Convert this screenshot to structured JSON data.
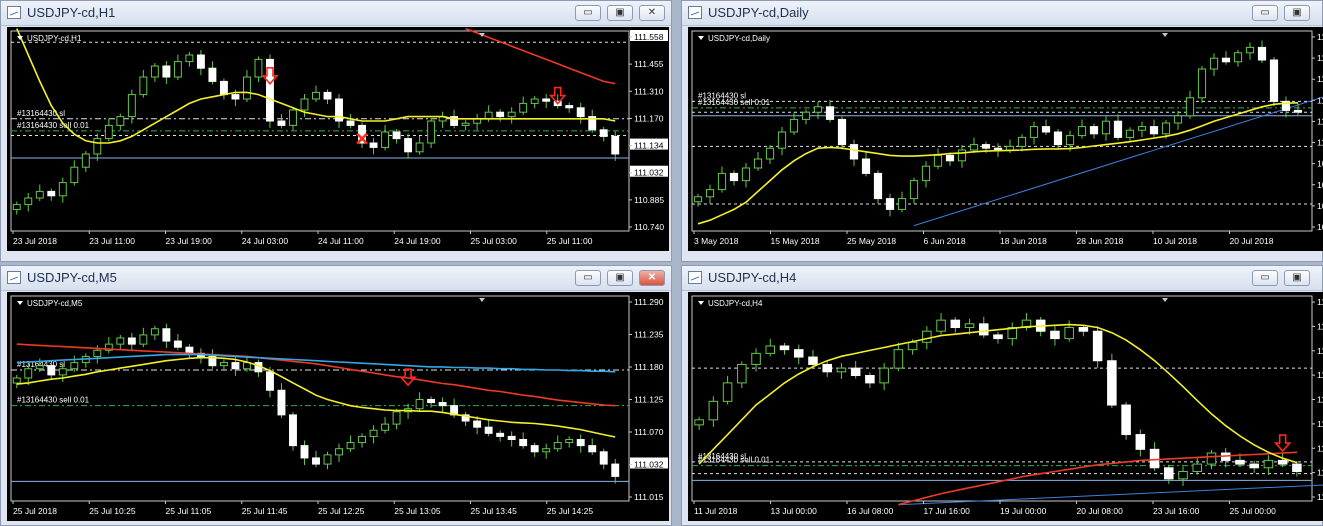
{
  "windows": [
    {
      "key": "h1",
      "title": "USDJPY-cd,H1",
      "active": false,
      "controls": {
        "minimize": "▭",
        "restore": "▣",
        "close": "✕"
      },
      "chart_data": {
        "type": "candlestick",
        "label": "USDJPY-cd,H1",
        "ylim": [
          110.7,
          111.6
        ],
        "price_ticks": [
          "111.558",
          "111.455",
          "111.310",
          "111.170",
          "111.134",
          "111.032",
          "110.885",
          "110.740"
        ],
        "highlight_ticks": [
          "111.558",
          "111.134",
          "111.032"
        ],
        "x_labels": [
          "23 Jul 2018",
          "23 Jul 11:00",
          "23 Jul 19:00",
          "24 Jul 03:00",
          "24 Jul 11:00",
          "24 Jul 19:00",
          "25 Jul 03:00",
          "25 Jul 11:00"
        ],
        "close": [
          110.82,
          110.85,
          110.88,
          110.86,
          110.92,
          110.99,
          111.05,
          111.12,
          111.18,
          111.22,
          111.32,
          111.4,
          111.45,
          111.4,
          111.47,
          111.5,
          111.44,
          111.38,
          111.32,
          111.3,
          111.4,
          111.48,
          111.2,
          111.18,
          111.25,
          111.3,
          111.33,
          111.3,
          111.2,
          111.18,
          111.1,
          111.08,
          111.15,
          111.12,
          111.06,
          111.1,
          111.2,
          111.22,
          111.18,
          111.19,
          111.21,
          111.24,
          111.22,
          111.24,
          111.28,
          111.3,
          111.29,
          111.27,
          111.26,
          111.22,
          111.16,
          111.13,
          111.05
        ],
        "ma_yellow": [
          111.62,
          111.5,
          111.38,
          111.27,
          111.19,
          111.14,
          111.11,
          111.1,
          111.1,
          111.11,
          111.13,
          111.16,
          111.19,
          111.22,
          111.25,
          111.28,
          111.3,
          111.31,
          111.32,
          111.33,
          111.33,
          111.32,
          111.3,
          111.28,
          111.26,
          111.24,
          111.23,
          111.22,
          111.22,
          111.21,
          111.2,
          111.2,
          111.2,
          111.21,
          111.22,
          111.22,
          111.22,
          111.22,
          111.21,
          111.21,
          111.21,
          111.21,
          111.21,
          111.21,
          111.21,
          111.21,
          111.21,
          111.21,
          111.21,
          111.21,
          111.21,
          111.21,
          111.2
        ],
        "ma_red": [
          null,
          null,
          null,
          null,
          null,
          null,
          null,
          null,
          null,
          null,
          null,
          null,
          null,
          null,
          null,
          null,
          null,
          null,
          null,
          null,
          null,
          null,
          null,
          null,
          null,
          null,
          null,
          null,
          null,
          null,
          null,
          null,
          null,
          null,
          null,
          null,
          null,
          null,
          null,
          111.62,
          111.6,
          111.58,
          111.56,
          111.54,
          111.52,
          111.5,
          111.48,
          111.46,
          111.44,
          111.42,
          111.4,
          111.38,
          111.37
        ],
        "lines": [
          {
            "label": "#13164430 sl",
            "price": 111.21,
            "style": "dashdot",
            "color": "#e0e0e0"
          },
          {
            "label": "#13164430 sell 0.01",
            "price": 111.155,
            "style": "dashdot",
            "color": "#2fb34a"
          },
          {
            "label": "",
            "price": 111.134,
            "style": "dashed",
            "color": "#e0e0e0"
          },
          {
            "label": "",
            "price": 111.032,
            "style": "solid",
            "color": "#8ab4e8"
          },
          {
            "label": "",
            "price": 111.558,
            "style": "dashed",
            "color": "#e0e0e0"
          }
        ],
        "arrows": [
          {
            "index": 22,
            "price": 111.36
          },
          {
            "index": 47,
            "price": 111.27
          }
        ],
        "crosses": [
          {
            "index": 30,
            "price": 111.12
          }
        ]
      }
    },
    {
      "key": "daily",
      "title": "USDJPY-cd,Daily",
      "active": false,
      "controls": {
        "minimize": "▭",
        "restore": "▣",
        "close": "✕"
      },
      "chart_data": {
        "type": "candlestick",
        "label": "USDJPY-cd,Daily",
        "ylim": [
          107.8,
          113.3
        ],
        "price_ticks": [
          "11",
          "11",
          "11",
          "11",
          "11",
          "11",
          "10",
          "10",
          "10",
          "10"
        ],
        "highlight_ticks": [],
        "x_labels": [
          "3 May 2018",
          "15 May 2018",
          "25 May 2018",
          "6 Jun 2018",
          "18 Jun 2018",
          "28 Jun 2018",
          "10 Jul 2018",
          "20 Jul 2018"
        ],
        "close": [
          108.75,
          108.95,
          109.4,
          109.2,
          109.55,
          109.8,
          110.1,
          110.55,
          110.9,
          111.1,
          111.25,
          110.9,
          110.2,
          109.8,
          109.4,
          108.7,
          108.4,
          108.7,
          109.2,
          109.6,
          109.9,
          109.75,
          110.05,
          110.2,
          110.1,
          110.05,
          110.15,
          110.4,
          110.7,
          110.55,
          110.2,
          110.45,
          110.7,
          110.5,
          110.85,
          110.4,
          110.6,
          110.7,
          110.5,
          110.8,
          111.0,
          111.5,
          112.3,
          112.6,
          112.5,
          112.75,
          112.9,
          112.55,
          111.4,
          111.15,
          111.1
        ],
        "ma_yellow": [
          108.0,
          108.1,
          108.25,
          108.4,
          108.6,
          108.9,
          109.2,
          109.5,
          109.75,
          109.95,
          110.1,
          110.12,
          110.1,
          110.05,
          110.0,
          109.95,
          109.9,
          109.88,
          109.88,
          109.9,
          109.92,
          109.95,
          109.97,
          110.0,
          110.02,
          110.03,
          110.04,
          110.05,
          110.07,
          110.08,
          110.08,
          110.09,
          110.12,
          110.16,
          110.2,
          110.24,
          110.28,
          110.33,
          110.38,
          110.43,
          110.5,
          110.6,
          110.72,
          110.85,
          110.95,
          111.05,
          111.15,
          111.25,
          111.32,
          111.35,
          111.36
        ],
        "ma_red": [],
        "lines": [
          {
            "label": "#13164430 sl",
            "price": 111.4,
            "style": "dashed",
            "color": "#e0e0e0"
          },
          {
            "label": "#13164430 sell 0.01",
            "price": 111.22,
            "style": "dashdot",
            "color": "#2fb34a"
          },
          {
            "label": "",
            "price": 111.1,
            "style": "dashed",
            "color": "#e0e0e0"
          },
          {
            "label": "",
            "price": 111.0,
            "style": "solid",
            "color": "#8ab4e8"
          },
          {
            "label": "",
            "price": 110.15,
            "style": "dashed",
            "color": "#e0e0e0"
          },
          {
            "label": "",
            "price": 108.55,
            "style": "dashed",
            "color": "#e0e0e0"
          }
        ],
        "trend": {
          "from": [
            18,
            107.95
          ],
          "to": [
            60,
            112.35
          ],
          "color": "#3f7fe0"
        },
        "arrows": [],
        "crosses": []
      }
    },
    {
      "key": "m5",
      "title": "USDJPY-cd,M5",
      "active": true,
      "controls": {
        "minimize": "▭",
        "restore": "▣",
        "close": "✕"
      },
      "chart_data": {
        "type": "candlestick",
        "label": "USDJPY-cd,M5",
        "ylim": [
          111.0,
          111.33
        ],
        "price_ticks": [
          "111.290",
          "111.235",
          "111.180",
          "111.125",
          "111.070",
          "111.032",
          "111.015"
        ],
        "highlight_ticks": [
          "111.032"
        ],
        "x_labels": [
          "25 Jul 2018",
          "25 Jul 10:25",
          "25 Jul 11:05",
          "25 Jul 11:45",
          "25 Jul 12:25",
          "25 Jul 13:05",
          "25 Jul 13:45",
          "25 Jul 14:25"
        ],
        "close": [
          111.2,
          111.215,
          111.22,
          111.205,
          111.215,
          111.225,
          111.235,
          111.245,
          111.255,
          111.265,
          111.255,
          111.27,
          111.28,
          111.26,
          111.25,
          111.24,
          111.235,
          111.22,
          111.225,
          111.215,
          111.225,
          111.21,
          111.18,
          111.14,
          111.09,
          111.07,
          111.06,
          111.075,
          111.085,
          111.095,
          111.105,
          111.115,
          111.125,
          111.145,
          111.15,
          111.165,
          111.16,
          111.155,
          111.14,
          111.13,
          111.12,
          111.11,
          111.105,
          111.1,
          111.09,
          111.08,
          111.085,
          111.095,
          111.1,
          111.09,
          111.08,
          111.06,
          111.04
        ],
        "ma_yellow": [
          111.19,
          111.192,
          111.195,
          111.198,
          111.2,
          111.203,
          111.206,
          111.21,
          111.213,
          111.216,
          111.219,
          111.222,
          111.225,
          111.228,
          111.23,
          111.232,
          111.233,
          111.233,
          111.232,
          111.23,
          111.226,
          111.22,
          111.212,
          111.202,
          111.192,
          111.182,
          111.172,
          111.165,
          111.16,
          111.155,
          111.152,
          111.15,
          111.148,
          111.147,
          111.147,
          111.146,
          111.146,
          111.144,
          111.141,
          111.138,
          111.135,
          111.132,
          111.13,
          111.128,
          111.127,
          111.126,
          111.124,
          111.122,
          111.119,
          111.116,
          111.112,
          111.108,
          111.104
        ],
        "ma_red": [
          111.255,
          111.254,
          111.253,
          111.252,
          111.251,
          111.25,
          111.249,
          111.248,
          111.247,
          111.246,
          111.245,
          111.244,
          111.243,
          111.242,
          111.241,
          111.24,
          111.239,
          111.238,
          111.237,
          111.236,
          111.235,
          111.233,
          111.231,
          111.229,
          111.227,
          111.225,
          111.223,
          111.22,
          111.217,
          111.214,
          111.211,
          111.208,
          111.205,
          111.202,
          111.2,
          111.197,
          111.194,
          111.191,
          111.189,
          111.186,
          111.183,
          111.18,
          111.178,
          111.175,
          111.172,
          111.17,
          111.167,
          111.164,
          111.162,
          111.16,
          111.158,
          111.156,
          111.155
        ],
        "ma_blue": [
          111.225,
          111.226,
          111.227,
          111.228,
          111.229,
          111.23,
          111.231,
          111.232,
          111.233,
          111.234,
          111.235,
          111.236,
          111.237,
          111.238,
          111.238,
          111.238,
          111.238,
          111.237,
          111.236,
          111.235,
          111.234,
          111.233,
          111.232,
          111.231,
          111.23,
          111.229,
          111.228,
          111.227,
          111.226,
          111.225,
          111.224,
          111.223,
          111.222,
          111.221,
          111.22,
          111.219,
          111.218,
          111.218,
          111.217,
          111.217,
          111.216,
          111.216,
          111.215,
          111.215,
          111.214,
          111.214,
          111.213,
          111.213,
          111.212,
          111.212,
          111.211,
          111.211,
          111.21
        ],
        "lines": [
          {
            "label": "#13164430 sl",
            "price": 111.213,
            "style": "dashdot",
            "color": "#e0e0e0"
          },
          {
            "label": "#13164430 sell 0.01",
            "price": 111.155,
            "style": "dashdot",
            "color": "#2fb34a"
          },
          {
            "label": "",
            "price": 111.032,
            "style": "solid",
            "color": "#8ab4e8"
          }
        ],
        "arrows": [
          {
            "index": 34,
            "price": 111.185
          }
        ],
        "crosses": []
      }
    },
    {
      "key": "h4",
      "title": "USDJPY-cd,H4",
      "active": false,
      "controls": {
        "minimize": "▭",
        "restore": "▣",
        "close": "✕"
      },
      "chart_data": {
        "type": "candlestick",
        "label": "USDJPY-cd,H4",
        "ylim": [
          110.5,
          113.25
        ],
        "price_ticks": [
          "11",
          "11",
          "11",
          "11",
          "11",
          "11",
          "11",
          "11",
          "11"
        ],
        "highlight_ticks": [],
        "x_labels": [
          "11 Jul 2018",
          "13 Jul 00:00",
          "16 Jul 08:00",
          "17 Jul 16:00",
          "19 Jul 00:00",
          "20 Jul 08:00",
          "23 Jul 16:00",
          "25 Jul 00:00"
        ],
        "close": [
          111.6,
          111.85,
          112.1,
          112.35,
          112.5,
          112.6,
          112.55,
          112.45,
          112.35,
          112.25,
          112.3,
          112.2,
          112.1,
          112.3,
          112.55,
          112.65,
          112.8,
          112.95,
          112.85,
          112.9,
          112.75,
          112.7,
          112.85,
          112.95,
          112.8,
          112.7,
          112.85,
          112.8,
          112.4,
          111.8,
          111.4,
          111.2,
          110.95,
          110.8,
          110.9,
          111.0,
          111.15,
          111.05,
          111.0,
          110.95,
          111.05,
          111.0,
          110.9
        ],
        "ma_yellow": [
          111.0,
          111.2,
          111.4,
          111.6,
          111.8,
          111.95,
          112.1,
          112.22,
          112.32,
          112.4,
          112.46,
          112.5,
          112.54,
          112.58,
          112.62,
          112.66,
          112.7,
          112.74,
          112.76,
          112.78,
          112.8,
          112.82,
          112.84,
          112.86,
          112.87,
          112.88,
          112.89,
          112.88,
          112.85,
          112.78,
          112.68,
          112.55,
          112.4,
          112.23,
          112.05,
          111.86,
          111.68,
          111.52,
          111.38,
          111.26,
          111.16,
          111.08,
          111.02
        ],
        "ma_red": [
          null,
          null,
          null,
          null,
          null,
          null,
          null,
          null,
          null,
          null,
          null,
          null,
          null,
          null,
          110.45,
          110.5,
          110.55,
          110.6,
          110.64,
          110.68,
          110.72,
          110.76,
          110.8,
          110.84,
          110.87,
          110.9,
          110.93,
          110.96,
          110.99,
          111.01,
          111.03,
          111.05,
          111.06,
          111.07,
          111.08,
          111.09,
          111.1,
          111.11,
          111.12,
          111.13,
          111.14,
          111.15,
          111.16
        ],
        "lines": [
          {
            "label": "",
            "price": 112.3,
            "style": "dashed",
            "color": "#e0e0e0"
          },
          {
            "label": "#13164430 sl",
            "price": 111.03,
            "style": "dashed",
            "color": "#e0e0e0"
          },
          {
            "label": "#13164430 sell 0.01",
            "price": 110.98,
            "style": "dashdot",
            "color": "#2fb34a"
          },
          {
            "label": "",
            "price": 110.87,
            "style": "dashed",
            "color": "#e0e0e0"
          },
          {
            "label": "",
            "price": 110.78,
            "style": "solid",
            "color": "#8ab4e8"
          }
        ],
        "trend": {
          "from": [
            14,
            110.45
          ],
          "to": [
            70,
            110.95
          ],
          "color": "#3f7fe0"
        },
        "arrows": [
          {
            "index": 41,
            "price": 111.15
          }
        ],
        "crosses": []
      }
    }
  ]
}
